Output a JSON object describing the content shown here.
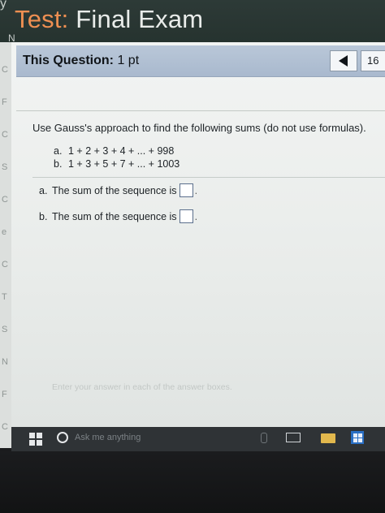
{
  "app": {
    "title_prefix": "Test:",
    "title_rest": " Final Exam",
    "edge_glyph_top": "y",
    "edge_glyph_n": "N"
  },
  "question_bar": {
    "label_bold": "This Question:",
    "label_points": " 1 pt",
    "nav_number": "16"
  },
  "left_strip_letters": [
    "C",
    "F",
    "C",
    "S",
    "C",
    "e",
    "C",
    "T",
    "S",
    "N",
    "F",
    "C"
  ],
  "problem": {
    "instructions": "Use Gauss's approach to find the following sums (do not use formulas).",
    "items": [
      {
        "tag": "a.",
        "text": "1 + 2 + 3 + 4 + ... + 998"
      },
      {
        "tag": "b.",
        "text": "1 + 3 + 5 + 7 + ... + 1003"
      }
    ],
    "answers": [
      {
        "tag": "a.",
        "text": "The sum of the sequence is",
        "value": ""
      },
      {
        "tag": "b.",
        "text": "The sum of the sequence is",
        "value": ""
      }
    ],
    "footer_hint": "Enter your answer in each of the answer boxes."
  },
  "taskbar": {
    "search_text": "Ask me anything"
  },
  "colors": {
    "header_bg": "#2d3a37",
    "title_accent": "#ee8f52",
    "question_bar": "#b9c7d8",
    "taskbar_bg": "#2f3336"
  }
}
